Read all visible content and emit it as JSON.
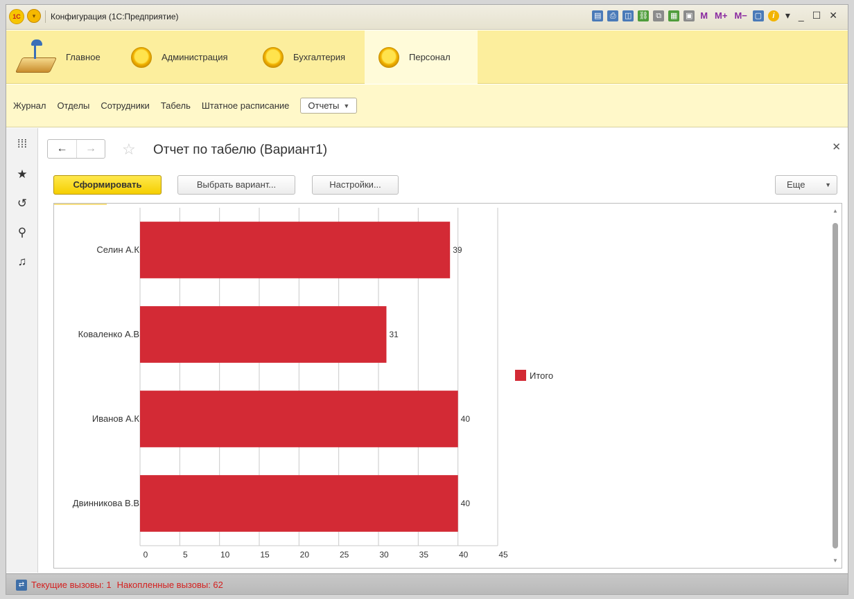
{
  "window": {
    "title": "Конфигурация (1С:Предприятие)",
    "logo": "1С",
    "toolbar_m": [
      "M",
      "M+",
      "M−"
    ]
  },
  "sections": [
    {
      "label": "Главное",
      "active": false
    },
    {
      "label": "Администрация",
      "active": false
    },
    {
      "label": "Бухгалтерия",
      "active": false
    },
    {
      "label": "Персонал",
      "active": true
    }
  ],
  "funcbar": {
    "links": [
      "Журнал",
      "Отделы",
      "Сотрудники",
      "Табель",
      "Штатное расписание"
    ],
    "dropdown_label": "Отчеты"
  },
  "form": {
    "title": "Отчет по табелю (Вариант1)",
    "generate_label": "Сформировать",
    "choose_variant_label": "Выбрать вариант...",
    "settings_label": "Настройки...",
    "more_label": "Еще"
  },
  "status": {
    "current_calls": "Текущие вызовы: 1",
    "accumulated_calls": "Накопленные вызовы: 62"
  },
  "colors": {
    "bar": "#d32a35",
    "section_panel": "#fcee9d",
    "primary_button": "#f5cf00"
  },
  "chart_data": {
    "type": "bar",
    "orientation": "horizontal",
    "categories": [
      "Селин А.К",
      "Коваленко А.В",
      "Иванов А.К",
      "Двинникова В.В"
    ],
    "series": [
      {
        "name": "Итого",
        "values": [
          39,
          31,
          40,
          40
        ]
      }
    ],
    "data_labels": [
      "39",
      "31",
      "40",
      "40"
    ],
    "x_ticks": [
      "0",
      "5",
      "10",
      "15",
      "20",
      "25",
      "30",
      "35",
      "40",
      "45"
    ],
    "xlim": [
      0,
      45
    ],
    "grid": true,
    "legend": "right"
  }
}
